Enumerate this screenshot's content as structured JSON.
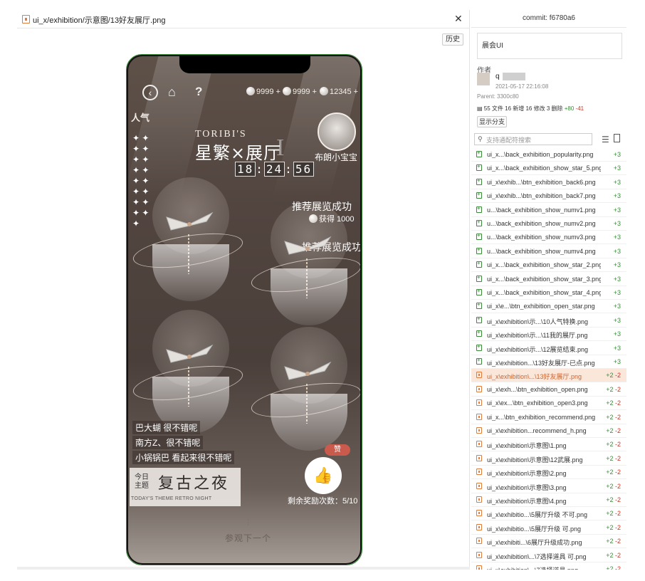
{
  "viewer": {
    "file_path": "ui_x/exhibition/示意图/13好友展厅.png",
    "history_label": "历史",
    "close_symbol": "✕"
  },
  "game": {
    "currencies": [
      "9999 +",
      "9999 +",
      "12345 +"
    ],
    "popularity_label": "人气",
    "title_en": "TORIBI'S",
    "title_cn": "星繁×展厅",
    "title_roman": "I",
    "timer": [
      "18",
      "24",
      "56"
    ],
    "friend_name": "布朗小宝宝",
    "recommend_success": "推荐展览成功",
    "reward_text": "获得 1000",
    "recommend_success_2": "推荐展览成功",
    "comments": [
      "巴大蝴  很不错呢",
      "南方Z、很不错呢",
      "小锅锅巴  看起来很不错呢"
    ],
    "theme_small": "今日主题",
    "theme_big": "复古之夜",
    "theme_en": "TODAY'S THEME RETRO NIGHT",
    "like_badge": "赞",
    "remaining_rewards": "剩余奖励次数：5/10",
    "next_visit": "参观下一个"
  },
  "panel": {
    "commit_title": "commit: f6780a6",
    "message": "晨会UI",
    "author_label": "作者",
    "author_name": "q",
    "author_date": "2021-05-17 22:16:08",
    "parent": "Parent: 3300c80",
    "stats_text": "55 文件 16 新增 16 修改 3 删除",
    "stats_add": "+80",
    "stats_del": "-41",
    "branch_label": "显示分支",
    "search_placeholder": "支持通配符搜索"
  },
  "files": [
    {
      "name": "ui_x...\\back_exhibition_popularity.png",
      "status": "add",
      "add": "+3",
      "del": ""
    },
    {
      "name": "ui_x...\\back_exhibition_show_star_5.png",
      "status": "add",
      "add": "+3",
      "del": ""
    },
    {
      "name": "ui_x\\exhib...\\btn_exhibition_back6.png",
      "status": "add",
      "add": "+3",
      "del": ""
    },
    {
      "name": "ui_x\\exhib...\\btn_exhibition_back7.png",
      "status": "add",
      "add": "+3",
      "del": ""
    },
    {
      "name": "u...\\back_exhibition_show_numv1.png",
      "status": "add",
      "add": "+3",
      "del": ""
    },
    {
      "name": "u...\\back_exhibition_show_numv2.png",
      "status": "add",
      "add": "+3",
      "del": ""
    },
    {
      "name": "u...\\back_exhibition_show_numv3.png",
      "status": "add",
      "add": "+3",
      "del": ""
    },
    {
      "name": "u...\\back_exhibition_show_numv4.png",
      "status": "add",
      "add": "+3",
      "del": ""
    },
    {
      "name": "ui_x...\\back_exhibition_show_star_2.png",
      "status": "add",
      "add": "+3",
      "del": ""
    },
    {
      "name": "ui_x...\\back_exhibition_show_star_3.png",
      "status": "add",
      "add": "+3",
      "del": ""
    },
    {
      "name": "ui_x...\\back_exhibition_show_star_4.png",
      "status": "add",
      "add": "+3",
      "del": ""
    },
    {
      "name": "ui_x\\e...\\btn_exhibition_open_star.png",
      "status": "add",
      "add": "+3",
      "del": ""
    },
    {
      "name": "ui_x\\exhibition\\示...\\10人气特换.png",
      "status": "add",
      "add": "+3",
      "del": ""
    },
    {
      "name": "ui_x\\exhibition\\示...\\11我的展厅.png",
      "status": "add",
      "add": "+3",
      "del": ""
    },
    {
      "name": "ui_x\\exhibition\\示...\\12展览结束.png",
      "status": "add",
      "add": "+3",
      "del": ""
    },
    {
      "name": "ui_x\\exhibition...\\13好友展厅-已点.png",
      "status": "add",
      "add": "+3",
      "del": ""
    },
    {
      "name": "ui_x\\exhibition\\...\\13好友展厅.png",
      "status": "mod",
      "add": "+2",
      "del": "-2",
      "selected": true
    },
    {
      "name": "ui_x\\exh...\\btn_exhibition_open.png",
      "status": "mod",
      "add": "+2",
      "del": "-2"
    },
    {
      "name": "ui_x\\ex...\\btn_exhibition_open3.png",
      "status": "mod",
      "add": "+2",
      "del": "-2"
    },
    {
      "name": "ui_x...\\btn_exhibition_recommend.png",
      "status": "mod",
      "add": "+2",
      "del": "-2"
    },
    {
      "name": "ui_x\\exhibition...recommend_h.png",
      "status": "mod",
      "add": "+2",
      "del": "-2"
    },
    {
      "name": "ui_x\\exhibition\\示意图\\1.png",
      "status": "mod",
      "add": "+2",
      "del": "-2"
    },
    {
      "name": "ui_x\\exhibition\\示意图\\12武展.png",
      "status": "mod",
      "add": "+2",
      "del": "-2"
    },
    {
      "name": "ui_x\\exhibition\\示意图\\2.png",
      "status": "mod",
      "add": "+2",
      "del": "-2"
    },
    {
      "name": "ui_x\\exhibition\\示意图\\3.png",
      "status": "mod",
      "add": "+2",
      "del": "-2"
    },
    {
      "name": "ui_x\\exhibition\\示意图\\4.png",
      "status": "mod",
      "add": "+2",
      "del": "-2"
    },
    {
      "name": "ui_x\\exhibitio...\\5展厅升级 不可.png",
      "status": "mod",
      "add": "+2",
      "del": "-2"
    },
    {
      "name": "ui_x\\exhibitio...\\5展厅升级 可.png",
      "status": "mod",
      "add": "+2",
      "del": "-2"
    },
    {
      "name": "ui_x\\exhibiti...\\6展厅升级成功.png",
      "status": "mod",
      "add": "+2",
      "del": "-2"
    },
    {
      "name": "ui_x\\exhibition\\...\\7选择道具 可.png",
      "status": "mod",
      "add": "+2",
      "del": "-2"
    },
    {
      "name": "ui_x\\exhibition\\...\\7选择道具.png",
      "status": "mod",
      "add": "+2",
      "del": "-2"
    }
  ]
}
